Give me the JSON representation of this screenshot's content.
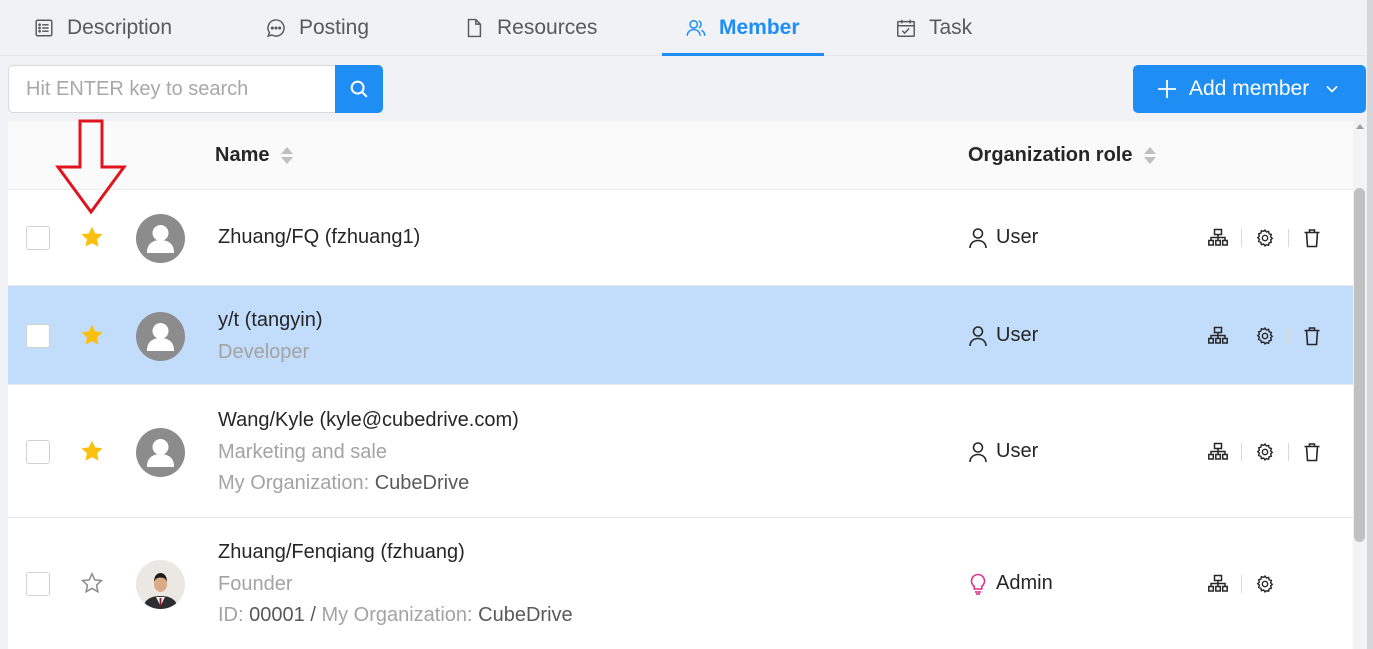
{
  "tabs": [
    {
      "label": "Description",
      "icon": "description-icon",
      "active": false
    },
    {
      "label": "Posting",
      "icon": "posting-icon",
      "active": false
    },
    {
      "label": "Resources",
      "icon": "file-icon",
      "active": false
    },
    {
      "label": "Member",
      "icon": "member-icon",
      "active": true
    },
    {
      "label": "Task",
      "icon": "task-icon",
      "active": false
    }
  ],
  "search": {
    "placeholder": "Hit ENTER key to search",
    "value": "",
    "icon": "search-icon"
  },
  "add_member": {
    "label": "Add member",
    "icon": "plus-icon",
    "dropdown_icon": "chevron-down-icon"
  },
  "columns": {
    "name": "Name",
    "role": "Organization role"
  },
  "rows": [
    {
      "starred": true,
      "selected": false,
      "avatar": "default",
      "name": "Zhuang/FQ (fzhuang1)",
      "role": "User",
      "role_icon": "user-icon",
      "actions": [
        "org-chart-icon",
        "gear-icon",
        "trash-icon"
      ]
    },
    {
      "starred": true,
      "selected": true,
      "avatar": "default",
      "name": "y/t (tangyin)",
      "title": "Developer",
      "role": "User",
      "role_icon": "user-icon",
      "actions": [
        "org-chart-icon",
        "gear-icon",
        "trash-icon"
      ]
    },
    {
      "starred": true,
      "selected": false,
      "avatar": "default",
      "name": "Wang/Kyle (kyle@cubedrive.com)",
      "title": "Marketing and sale",
      "org_label": "My Organization:",
      "org_value": "CubeDrive",
      "role": "User",
      "role_icon": "user-icon",
      "actions": [
        "org-chart-icon",
        "gear-icon",
        "trash-icon"
      ]
    },
    {
      "starred": false,
      "selected": false,
      "avatar": "photo",
      "name": "Zhuang/Fenqiang (fzhuang)",
      "title": "Founder",
      "id_label": "ID:",
      "id_value": "00001",
      "slash": "/",
      "org_label": "My Organization:",
      "org_value": "CubeDrive",
      "role": "Admin",
      "role_icon": "lightbulb-icon",
      "actions": [
        "org-chart-icon",
        "gear-icon"
      ]
    }
  ],
  "colors": {
    "accent": "#1e8ef4",
    "star": "#fbbf0e",
    "selected_row": "#c2dcfb",
    "admin_icon": "#e0308d",
    "annotation_arrow": "#e0141e"
  }
}
